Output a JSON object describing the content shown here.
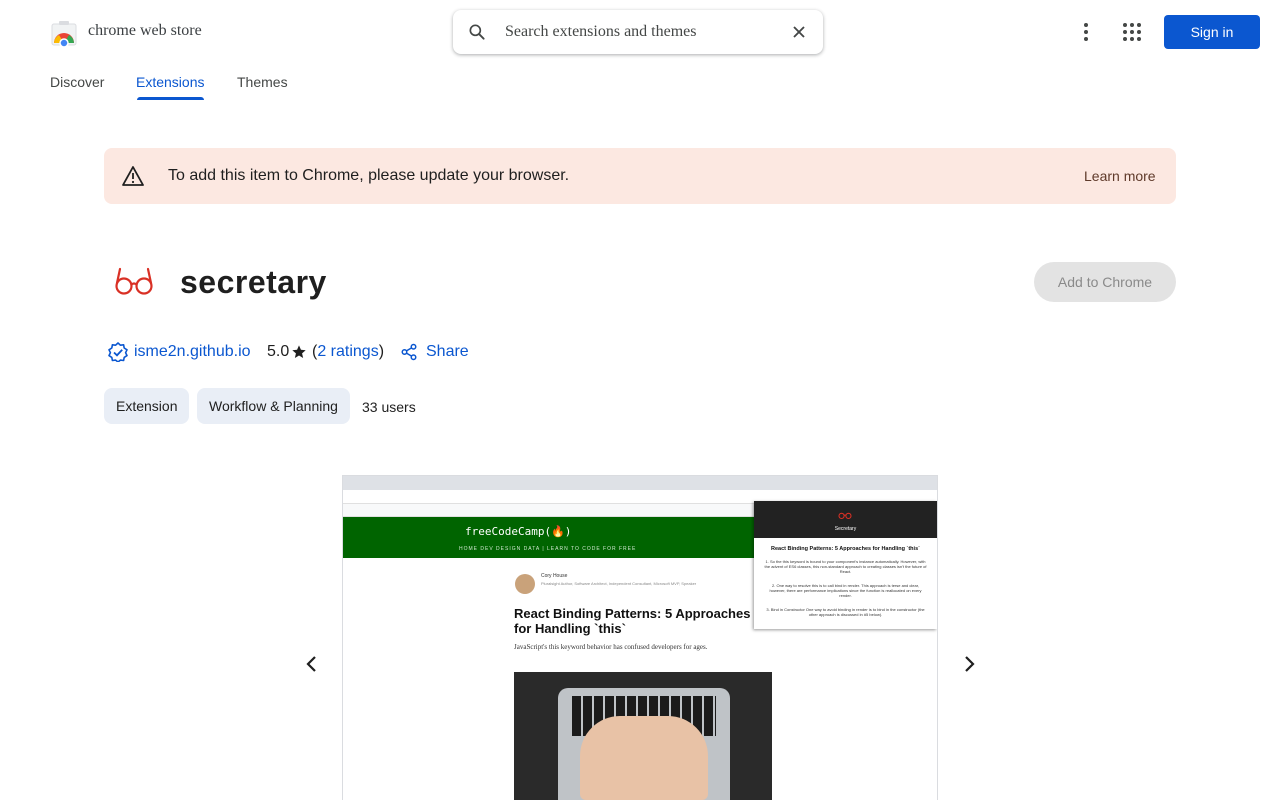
{
  "header": {
    "brand": "chrome web store",
    "search_placeholder": "Search extensions and themes",
    "sign_in": "Sign in"
  },
  "nav": {
    "tabs": [
      "Discover",
      "Extensions",
      "Themes"
    ],
    "active": "Extensions"
  },
  "banner": {
    "message": "To add this item to Chrome, please update your browser.",
    "link": "Learn more"
  },
  "extension": {
    "name": "secretary",
    "add_button": "Add to Chrome",
    "domain": "isme2n.github.io",
    "rating": "5.0",
    "ratings_open": "(",
    "ratings_link": "2 ratings",
    "ratings_close": ")",
    "share": "Share",
    "chips": [
      "Extension",
      "Workflow & Planning"
    ],
    "users": "33 users"
  },
  "screenshot": {
    "site": "freeCodeCamp(🔥)",
    "site_nav": "HOME   DEV   DESIGN   DATA   |   LEARN TO CODE FOR FREE",
    "author": "Cory House",
    "author_sub": "Pluralsight Author, Software Architect, Independent Consultant, Microsoft MVP, Speaker",
    "article_title": "React Binding Patterns: 5 Approaches for Handling `this`",
    "article_sub": "JavaScript's this keyword behavior has confused developers for ages.",
    "popup_name": "Secretary",
    "popup_title": "React Binding Patterns: 5 Approaches for Handling `this`",
    "popup_lines": [
      "1. So the this keyword is bound to your component's instance automatically. However, with the advent of ES6 classes, this non-standard approach to creating classes isn't the future of React.",
      "2. One way to resolve this is to call bind in render. This approach is terse and clear, however, there are performance implications since the function is reallocated on every render.",
      "3. Bind in Constructor One way to avoid binding in render is to bind in the constructor (the other approach is discussed in #5 below)."
    ]
  },
  "colors": {
    "accent": "#0b57d0",
    "banner_bg": "#fce8e1",
    "chip_bg": "#e9eef6",
    "icon_red": "#d93025"
  },
  "icons": [
    "chrome-web-store-logo",
    "search-icon",
    "close-icon",
    "more-vert-icon",
    "apps-icon",
    "warning-icon",
    "glasses-icon",
    "verified-icon",
    "star-icon",
    "share-icon",
    "chevron-left-icon",
    "chevron-right-icon"
  ]
}
